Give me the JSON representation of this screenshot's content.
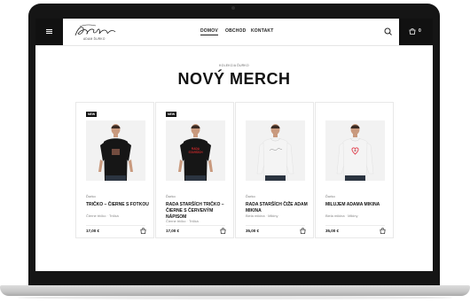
{
  "header": {
    "logo_alt": "Adam Ďurko",
    "nav": [
      {
        "label": "DOMOV",
        "active": true
      },
      {
        "label": "OBCHOD",
        "active": false
      },
      {
        "label": "KONTAKT",
        "active": false
      }
    ],
    "cart_count": "0"
  },
  "hero": {
    "breadcrumb": "KOLEKCIA ĎURKO",
    "title": "NOVÝ MERCH"
  },
  "products": [
    {
      "badge": "NEW",
      "brand": "Ďurko",
      "name": "TRIČKO – ČIERNE S FOTKOU",
      "cat1": "Čierne tričko",
      "cat2": "Tričká",
      "price": "17,00 €",
      "shirt": "#161616",
      "print": "photo"
    },
    {
      "badge": "NEW",
      "brand": "Ďurko",
      "name": "RADA STARŠÍCH TRIČKO – ČIERNE S ČERVENÝM NÁPISOM",
      "cat1": "Čierne tričko",
      "cat2": "Tričká",
      "price": "17,00 €",
      "shirt": "#161616",
      "print": "text"
    },
    {
      "badge": "",
      "brand": "Ďurko",
      "name": "RADA STARŠÍCH ČIŽE ADAM MIKINA",
      "cat1": "Biela mikina",
      "cat2": "Mikiny",
      "price": "35,00 €",
      "shirt": "#f4f4f4",
      "print": "script"
    },
    {
      "badge": "",
      "brand": "Ďurko",
      "name": "MILUJEM ADAMA MIKINA",
      "cat1": "Biela mikina",
      "cat2": "Mikiny",
      "price": "35,00 €",
      "shirt": "#f4f4f4",
      "print": "heart"
    }
  ],
  "colors": {
    "accent": "#111111",
    "print_red": "#c8282a",
    "heart": "#e23b4a"
  },
  "icons": {
    "menu": "hamburger-icon",
    "search": "search-icon",
    "cart": "cart-icon",
    "add": "shopping-bag-icon"
  }
}
